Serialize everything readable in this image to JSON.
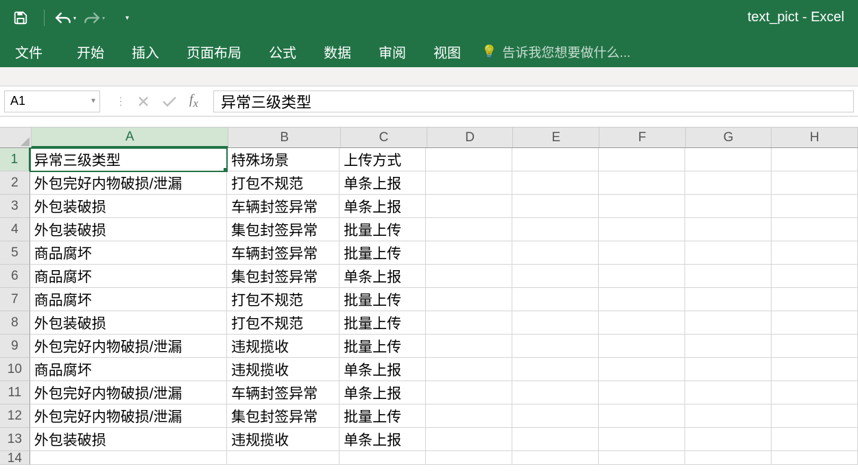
{
  "app": {
    "title": "text_pict - Excel"
  },
  "qat": {
    "save": "保存",
    "undo": "撤销",
    "redo": "重做"
  },
  "tabs": {
    "file": "文件",
    "home": "开始",
    "insert": "插入",
    "pageLayout": "页面布局",
    "formulas": "公式",
    "data": "数据",
    "review": "审阅",
    "view": "视图"
  },
  "tellMe": "告诉我您想要做什么...",
  "nameBox": "A1",
  "formulaBar": "异常三级类型",
  "columns": [
    "A",
    "B",
    "C",
    "D",
    "E",
    "F",
    "G",
    "H"
  ],
  "selected": {
    "row": 1,
    "col": "A"
  },
  "sheet": {
    "rows": [
      {
        "n": 1,
        "A": "异常三级类型",
        "B": "特殊场景",
        "C": "上传方式"
      },
      {
        "n": 2,
        "A": "外包完好内物破损/泄漏",
        "B": "打包不规范",
        "C": "单条上报"
      },
      {
        "n": 3,
        "A": "外包装破损",
        "B": "车辆封签异常",
        "C": "单条上报"
      },
      {
        "n": 4,
        "A": "外包装破损",
        "B": "集包封签异常",
        "C": "批量上传"
      },
      {
        "n": 5,
        "A": "商品腐坏",
        "B": "车辆封签异常",
        "C": "批量上传"
      },
      {
        "n": 6,
        "A": "商品腐坏",
        "B": "集包封签异常",
        "C": "单条上报"
      },
      {
        "n": 7,
        "A": "商品腐坏",
        "B": "打包不规范",
        "C": "批量上传"
      },
      {
        "n": 8,
        "A": "外包装破损",
        "B": "打包不规范",
        "C": "批量上传"
      },
      {
        "n": 9,
        "A": "外包完好内物破损/泄漏",
        "B": "违规揽收",
        "C": "批量上传"
      },
      {
        "n": 10,
        "A": "商品腐坏",
        "B": "违规揽收",
        "C": "单条上报"
      },
      {
        "n": 11,
        "A": "外包完好内物破损/泄漏",
        "B": "车辆封签异常",
        "C": "单条上报"
      },
      {
        "n": 12,
        "A": "外包完好内物破损/泄漏",
        "B": "集包封签异常",
        "C": "批量上传"
      },
      {
        "n": 13,
        "A": "外包装破损",
        "B": "违规揽收",
        "C": "单条上报"
      },
      {
        "n": 14,
        "A": "",
        "B": "",
        "C": ""
      }
    ]
  }
}
